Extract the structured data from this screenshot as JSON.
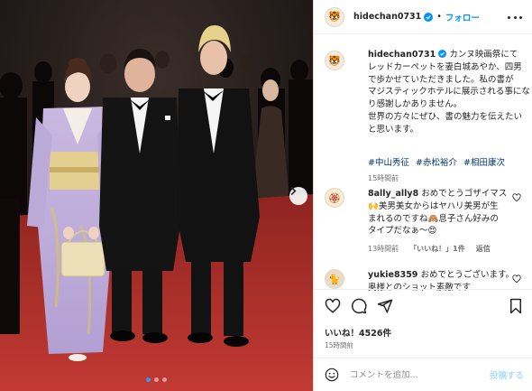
{
  "post": {
    "username": "hidechan0731",
    "follow_label": "フォロー",
    "separator": "•",
    "avatar_glyph": "🐯",
    "caption_lines": [
      "カンヌ映画祭にて",
      "レッドカーペットを妻白城あやか、四男",
      "で歩かせていただきました。私の書が",
      "マジスティックホテルに展示される事にな",
      "り感謝しかありません。",
      "世界の方々にぜひ、書の魅力を伝えたい",
      "と思います。"
    ],
    "hashtags": [
      "#中山秀征",
      "#赤松裕介",
      "#相田康次"
    ],
    "caption_time": "15時間前",
    "likes_text": "いいね！4526件",
    "post_time": "15時間前"
  },
  "comments": [
    {
      "username": "8ally_ally8",
      "avatar_glyph": "🏵",
      "lines": [
        "おめでとうゴザイマス",
        "🙌美男美女からはヤハリ美男が生",
        "まれるのですね🙈息子さん好みの",
        "タイプだなぁ〜😍"
      ],
      "time": "13時間前",
      "likes": "「いいね！」1件",
      "reply": "返信"
    },
    {
      "username": "yukie8359",
      "avatar_glyph": "🐈",
      "lines": [
        "おめでとうございます。",
        "奥様とのショット素敵です"
      ]
    }
  ],
  "comment_box": {
    "emoji_icon": "smiley-icon",
    "placeholder": "コメントを追加...",
    "post_label": "投稿する"
  },
  "carousel": {
    "slides": 3,
    "active_index": 0
  },
  "colors": {
    "link": "#0095f6",
    "hashtag": "#00376b",
    "carousel_active": "#3797f0",
    "red_carpet": "#b5302b"
  }
}
